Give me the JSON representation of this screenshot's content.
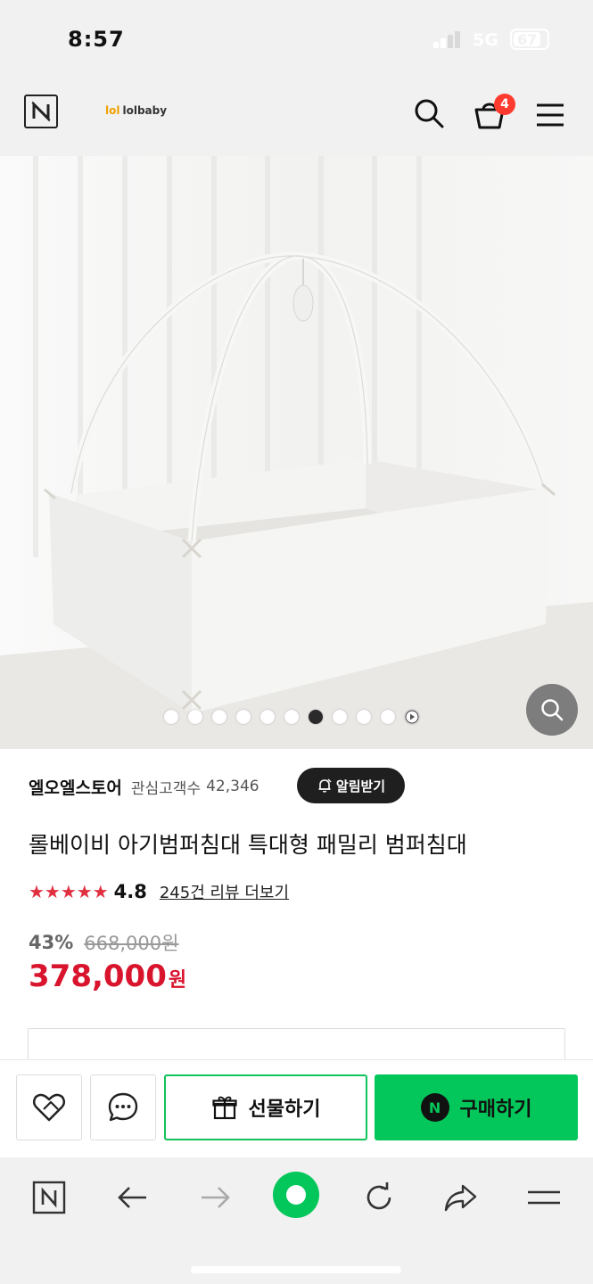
{
  "status_bar": {
    "time": "8:57",
    "network": "5G",
    "battery": "67"
  },
  "header": {
    "brand_name": "lolbaby",
    "brand_mark": "lol",
    "cart_count": "4",
    "icons": [
      "naver-logo-icon",
      "search-icon",
      "cart-icon",
      "menu-icon"
    ]
  },
  "gallery": {
    "total_images": 10,
    "active_index": 6
  },
  "store": {
    "name": "엘오엘스토어",
    "followers_label": "관심고객수",
    "followers_count": "42,346",
    "alarm_label": "알림받기"
  },
  "product": {
    "title": "롤베이비 아기범퍼침대 특대형 패밀리 범퍼침대",
    "stars": "★★★★★",
    "rating": "4.8",
    "reviews": "245건 리뷰 더보기",
    "discount": "43%",
    "original_price": "668,000원",
    "price": "378,000",
    "currency": "원"
  },
  "actions": {
    "gift_label": "선물하기",
    "buy_label": "구매하기",
    "buy_badge": "N"
  },
  "colors": {
    "accent_green": "#03c75a",
    "price_red": "#d9142d",
    "badge_red": "#ff3b30"
  }
}
